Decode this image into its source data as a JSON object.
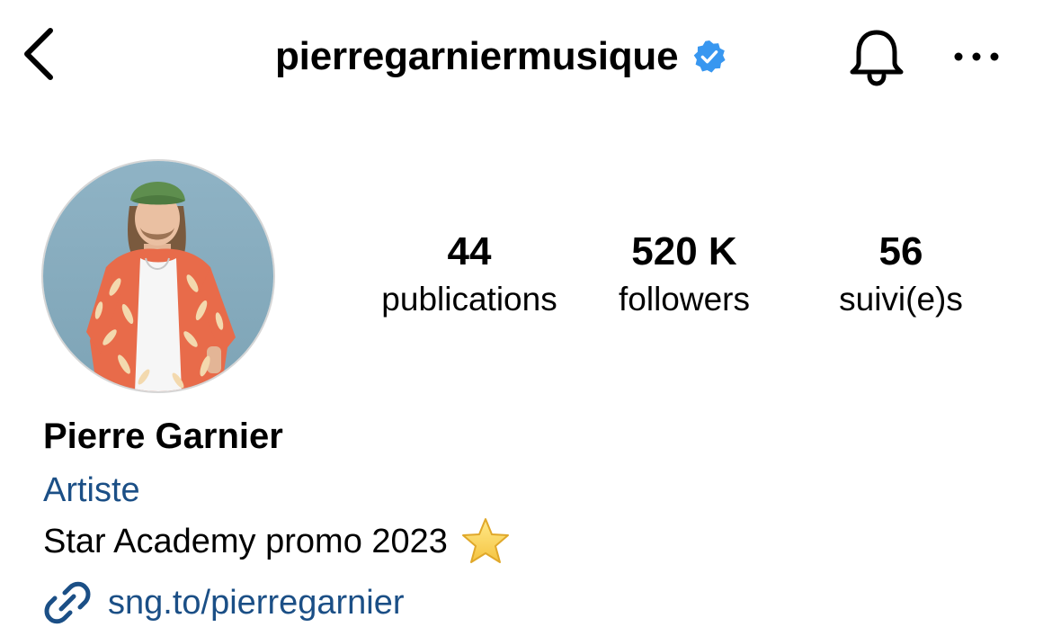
{
  "header": {
    "username": "pierregarniermusique",
    "verified": true,
    "icons": {
      "back": "chevron-left-icon",
      "verified": "verified-badge-icon",
      "notifications": "bell-icon",
      "more": "more-horizontal-icon"
    }
  },
  "profile": {
    "avatar": "profile-photo",
    "stats": [
      {
        "count": "44",
        "label": "publications"
      },
      {
        "count": "520 K",
        "label": "followers"
      },
      {
        "count": "56",
        "label": "suivi(e)s"
      }
    ],
    "display_name": "Pierre Garnier",
    "category": "Artiste",
    "bio": "Star Academy promo 2023",
    "bio_emoji": "star-emoji",
    "link": "sng.to/pierregarnier",
    "link_icon": "link-icon"
  },
  "colors": {
    "text": "#000000",
    "link": "#1b4f86",
    "verified": "#3897f0",
    "background": "#ffffff"
  }
}
